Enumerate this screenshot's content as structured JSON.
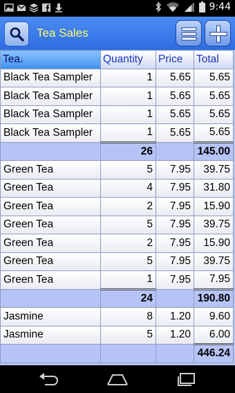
{
  "status_bar": {
    "time": "9:44",
    "icons": [
      "image-icon",
      "gmail-icon",
      "stack-icon",
      "facebook-icon",
      "download-icon",
      "bluetooth-icon",
      "wifi-icon",
      "signal-icon",
      "battery-icon"
    ]
  },
  "action_bar": {
    "title": "Tea Sales",
    "search_icon": "search-icon",
    "menu_icon": "menu-icon",
    "add_icon": "plus-icon"
  },
  "table": {
    "headers": [
      "Tea",
      "Quantity",
      "Price",
      "Total"
    ],
    "sorted_column": "Tea",
    "groups": [
      {
        "rows": [
          [
            "Black Tea Sampler",
            "1",
            "5.65",
            "5.65"
          ],
          [
            "Black Tea Sampler",
            "1",
            "5.65",
            "5.65"
          ],
          [
            "Black Tea Sampler",
            "1",
            "5.65",
            "5.65"
          ],
          [
            "Black Tea Sampler",
            "1",
            "5.65",
            "5.65"
          ]
        ],
        "qty_sum": "26",
        "total_sum": "145.00"
      },
      {
        "rows": [
          [
            "Green Tea",
            "5",
            "7.95",
            "39.75"
          ],
          [
            "Green Tea",
            "4",
            "7.95",
            "31.80"
          ],
          [
            "Green Tea",
            "2",
            "7.95",
            "15.90"
          ],
          [
            "Green Tea",
            "5",
            "7.95",
            "39.75"
          ],
          [
            "Green Tea",
            "2",
            "7.95",
            "15.90"
          ],
          [
            "Green Tea",
            "5",
            "7.95",
            "39.75"
          ],
          [
            "Green Tea",
            "1",
            "7.95",
            "7.95"
          ]
        ],
        "qty_sum": "24",
        "total_sum": "190.80"
      },
      {
        "rows": [
          [
            "Jasmine",
            "8",
            "1.20",
            "9.60"
          ],
          [
            "Jasmine",
            "5",
            "1.20",
            "6.00"
          ]
        ],
        "qty_sum": "",
        "total_sum": "446.24"
      }
    ]
  },
  "nav_bar": {
    "icons": [
      "back-icon",
      "home-icon",
      "recents-icon"
    ]
  },
  "colors": {
    "action_bar": "#3a7ceb",
    "title_text": "#fffb6a",
    "group_row": "#b6c3f6",
    "header_text": "#1a35b8"
  }
}
